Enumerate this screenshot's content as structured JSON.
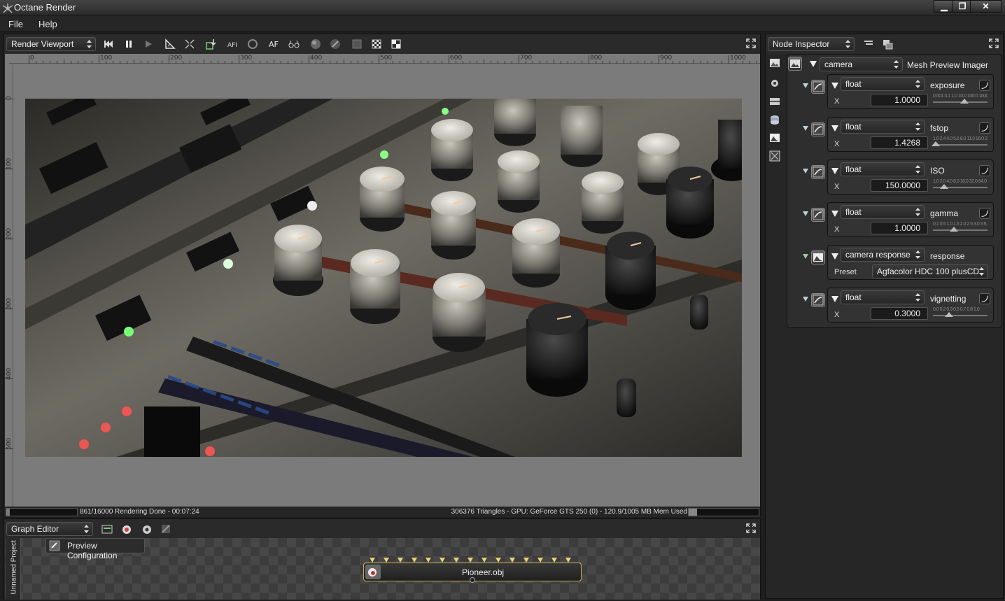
{
  "app": {
    "title": "Octane Render"
  },
  "menu": {
    "items": [
      "File",
      "Help"
    ]
  },
  "viewport": {
    "selector": "Render Viewport",
    "ruler_h": [
      "0",
      "100",
      "200",
      "300",
      "400",
      "500",
      "600",
      "700",
      "800",
      "900",
      "1000"
    ],
    "ruler_v": [
      "0",
      "100",
      "200",
      "300",
      "400",
      "500"
    ],
    "status_left": "861/16000 Rendering Done - 00:07:24",
    "status_right": "306376 Triangles - GPU: GeForce GTS 250 (0) - 120.9/1005 MB Mem Used",
    "progress": 0.0538,
    "mem_used": 0.12
  },
  "inspector": {
    "selector": "Node Inspector",
    "camera_type": "camera",
    "root_label": "Mesh Preview Imager",
    "params": [
      {
        "type": "float",
        "name": "exposure",
        "axis": "X",
        "value": "1.0000",
        "scale": "0.001 0.1 1.0 10.0 100.0 1000",
        "level": 0.58
      },
      {
        "type": "float",
        "name": "fstop",
        "axis": "X",
        "value": "1.4268",
        "scale": "1.0 2.4 4.0 5.6 8.0 11.0 16.0 22.0",
        "level": 0.05
      },
      {
        "type": "float",
        "name": "ISO",
        "axis": "X",
        "value": "150.0000",
        "scale": "1.0 2.0 4.0 8.0 16.0 32.0 64.0 128.0 200.0 800.0",
        "level": 0.2
      },
      {
        "type": "float",
        "name": "gamma",
        "axis": "X",
        "value": "1.0000",
        "scale": "0.1 0.5 1.0 1.5 2.0 2.5 3.0 3.5 4.0",
        "level": 0.38
      },
      {
        "type": "float",
        "name": "vignetting",
        "axis": "X",
        "value": "0.3000",
        "scale": "0.0 0.2 0.3 0.5 0.7 0.8 1.0",
        "level": 0.3
      }
    ],
    "response": {
      "type": "camera response",
      "name": "response",
      "preset_label": "Preset",
      "preset_value": "Agfacolor HDC 100 plusCD"
    }
  },
  "graph": {
    "selector": "Graph Editor",
    "preview_config": "Preview Configuration",
    "node_label": "Pioneer.obj",
    "side_tab": "Unnamed Project"
  },
  "colors": {
    "accent": "#c8b04a",
    "panel": "#262626",
    "viewport_bg": "#7b7b7b"
  }
}
